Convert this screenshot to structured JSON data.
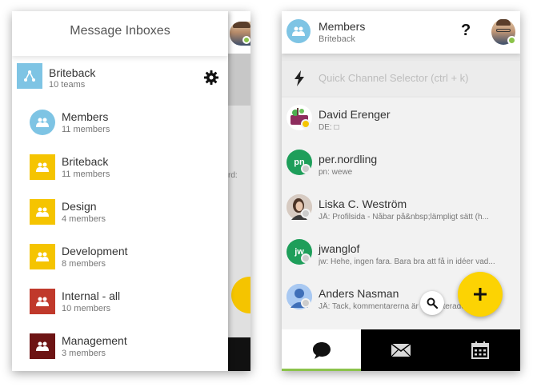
{
  "drawer": {
    "title": "Message Inboxes",
    "org": {
      "name": "Briteback",
      "sub": "10 teams",
      "icon": "network-icon",
      "color": "#7ec4e4"
    },
    "inboxes": [
      {
        "name": "Members",
        "sub": "11 members",
        "color": "#7ec4e4",
        "shape": "circle"
      },
      {
        "name": "Briteback",
        "sub": "11 members",
        "color": "#f5c400",
        "shape": "square"
      },
      {
        "name": "Design",
        "sub": "4 members",
        "color": "#f5c400",
        "shape": "square"
      },
      {
        "name": "Development",
        "sub": "8 members",
        "color": "#f5c400",
        "shape": "square"
      },
      {
        "name": "Internal - all",
        "sub": "10 members",
        "color": "#c0392b",
        "shape": "square"
      },
      {
        "name": "Management",
        "sub": "3 members",
        "color": "#6d1414",
        "shape": "square"
      }
    ],
    "background_fragment": "rd:"
  },
  "channel": {
    "title": "Members",
    "sub": "Briteback",
    "help_label": "?",
    "quick_placeholder": "Quick Channel Selector (ctrl + k)"
  },
  "conversations": [
    {
      "name": "David Erenger",
      "preview": "DE: □",
      "avatar": "image",
      "status": "#f5c400",
      "avatar_bg": "#ffffff"
    },
    {
      "name": "per.nordling",
      "preview": "pn: wewe",
      "avatar": "pn",
      "status": "#cccccc",
      "avatar_bg": "#1e9e5a"
    },
    {
      "name": "Liska C. Weström",
      "preview": "JÅ: Profilsida - Nåbar på&nbsp;lämpligt sätt (h...",
      "avatar": "image",
      "status": "#cccccc",
      "avatar_bg": "#d7cbc2"
    },
    {
      "name": "jwanglof",
      "preview": "jw: Hehe, ingen fara. Bara bra att få in idéer vad...",
      "avatar": "jw",
      "status": "#cccccc",
      "avatar_bg": "#1e9e5a"
    },
    {
      "name": "Anders Nasman",
      "preview": "JÅ: Tack, kommentarerna är uppdaterade",
      "avatar": "image",
      "status": "#cccccc",
      "avatar_bg": "#a9c9f2"
    }
  ],
  "bottom_nav": [
    {
      "icon": "chat-icon",
      "active": true
    },
    {
      "icon": "mail-icon",
      "active": false
    },
    {
      "icon": "calendar-icon",
      "active": false
    }
  ],
  "accent": {
    "yellow": "#fcd303",
    "green": "#8bc34a",
    "blue": "#7ec4e4"
  }
}
